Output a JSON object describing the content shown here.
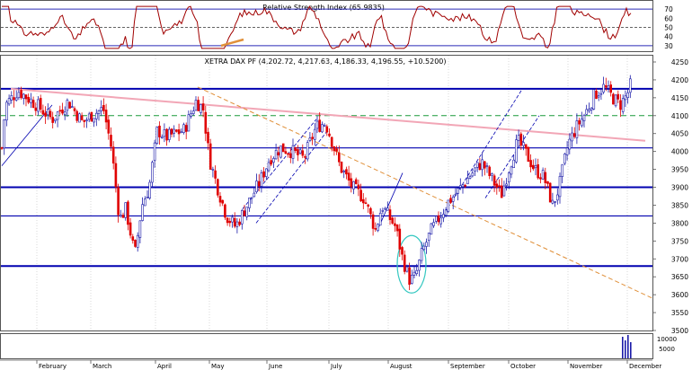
{
  "rsi": {
    "title": "Relative Strength Index (65.9835)",
    "ticks": [
      "70",
      "60",
      "50",
      "40",
      "30"
    ],
    "tick_values": [
      70,
      60,
      50,
      40,
      30
    ],
    "reference_lines": [
      70,
      50,
      30
    ],
    "ylim": [
      24,
      76
    ]
  },
  "price": {
    "title": "XETRA DAX PF (4,202.72, 4,217.63, 4,186.33, 4,196.55, +10.5200)",
    "ticks": [
      "4250",
      "4200",
      "4150",
      "4100",
      "4050",
      "4000",
      "3950",
      "3900",
      "3850",
      "3800",
      "3750",
      "3700",
      "3650",
      "3600",
      "3550",
      "3500"
    ],
    "tick_values": [
      4250,
      4200,
      4150,
      4100,
      4050,
      4000,
      3950,
      3900,
      3850,
      3800,
      3750,
      3700,
      3650,
      3600,
      3550,
      3500
    ],
    "ylim": [
      3500,
      4260
    ],
    "support_resistance_levels": [
      4175,
      4010,
      3900,
      3820,
      3680
    ],
    "dashed_level": 4100,
    "annotations": {
      "pink_trendline": [
        [
          "Jan",
          4175
        ],
        [
          "Dec",
          4030
        ]
      ],
      "orange_dashed_trendline": [
        [
          "May",
          4180
        ],
        [
          "Dec",
          3590
        ]
      ],
      "highlight_ellipse": {
        "month": "August",
        "low": 3615,
        "high": 3745
      }
    }
  },
  "volume": {
    "ticks": [
      "10000",
      "5000"
    ],
    "tick_values": [
      10000,
      5000
    ]
  },
  "x_axis": {
    "months": [
      "February",
      "March",
      "April",
      "May",
      "June",
      "July",
      "August",
      "September",
      "October",
      "November",
      "December"
    ]
  },
  "colors": {
    "up": "#1a1aa8",
    "down": "#e00000",
    "rsi_line": "#a00000",
    "level_line": "#0000b0",
    "dashed_green": "#1a9a3a",
    "pink": "#f2a6b6",
    "orange": "#e0903a",
    "ellipse": "#33c7c0"
  },
  "chart_data": {
    "type": "line",
    "title": "XETRA DAX PF (4,202.72, 4,217.63, 4,186.33, 4,196.55, +10.5200)",
    "xlabel": "",
    "ylabel": "",
    "ylim": [
      3500,
      4260
    ],
    "x": [
      "Feb",
      "Mar",
      "Apr",
      "May",
      "Jun",
      "Jul",
      "Aug",
      "Sep",
      "Oct",
      "Nov",
      "Dec"
    ],
    "series": [
      {
        "values": [
          4130,
          3760,
          4090,
          3810,
          3960,
          4060,
          3680,
          3930,
          3960,
          4150,
          4196.55
        ]
      }
    ],
    "volume_spike_month": "December"
  }
}
